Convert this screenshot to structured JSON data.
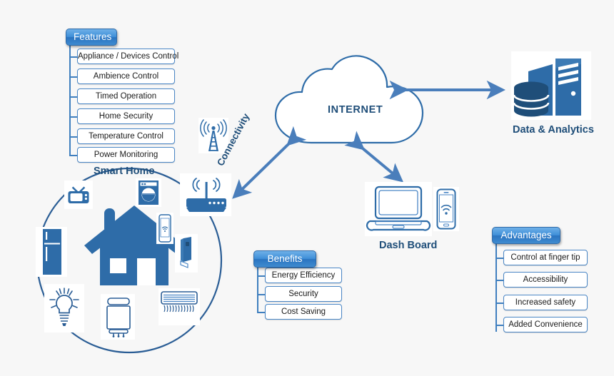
{
  "diagram": {
    "title_hidden": "Smart Home IoT Architecture",
    "colors": {
      "accent_blue": "#2e6ca8",
      "line_blue": "#4a86c5",
      "arrow_blue": "#4a7ebb",
      "label_navy": "#1f4e79",
      "background": "#f7f7f7"
    }
  },
  "features": {
    "header": "Features",
    "items": [
      "Appliance / Devices Control",
      "Ambience Control",
      "Timed Operation",
      "Home Security",
      "Temperature Control",
      "Power Monitoring"
    ]
  },
  "benefits": {
    "header": "Benefits",
    "items": [
      "Energy Efficiency",
      "Security",
      "Cost Saving"
    ]
  },
  "advantages": {
    "header": "Advantages",
    "items": [
      "Control at finger tip",
      "Accessibility",
      "Increased safety",
      "Added Convenience"
    ]
  },
  "nodes": {
    "smart_home": "Smart Home",
    "connectivity": "Connectivity",
    "internet": "INTERNET",
    "data_analytics": "Data & Analytics",
    "dash_board": "Dash Board"
  },
  "icons": {
    "tower": "cell-tower-icon",
    "router": "wifi-router-icon",
    "house": "house-icon",
    "tv": "television-icon",
    "washing_machine": "washing-machine-icon",
    "refrigerator": "refrigerator-icon",
    "smartphone": "smartphone-wifi-icon",
    "door_lock": "smart-door-lock-icon",
    "light_bulb": "light-bulb-icon",
    "water_heater": "water-heater-icon",
    "air_conditioner": "air-conditioner-icon",
    "cloud": "internet-cloud-icon",
    "server": "data-server-icon",
    "database": "database-icon",
    "laptop": "laptop-icon",
    "phone_dash": "phone-wifi-icon"
  }
}
